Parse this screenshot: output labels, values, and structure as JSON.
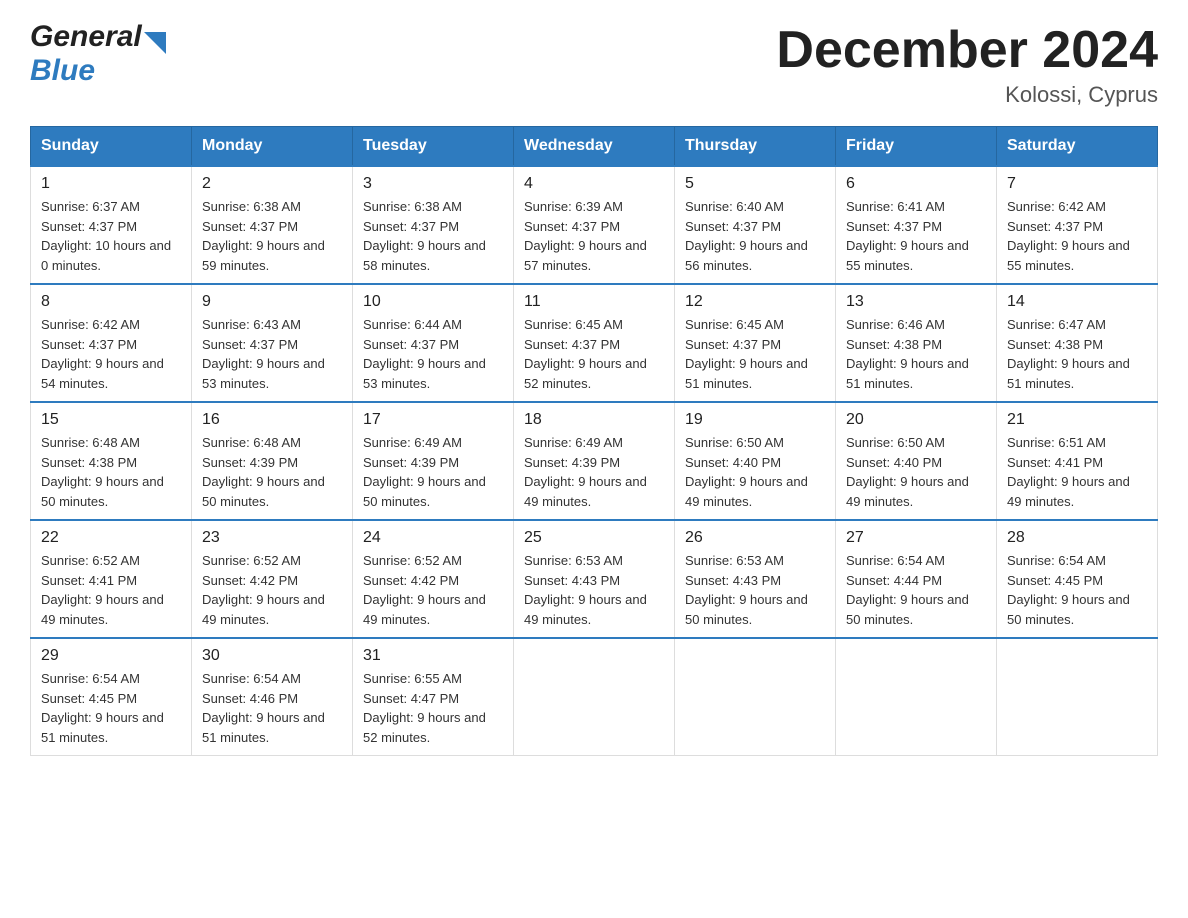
{
  "header": {
    "logo_general": "General",
    "logo_blue": "Blue",
    "title": "December 2024",
    "subtitle": "Kolossi, Cyprus"
  },
  "days_of_week": [
    "Sunday",
    "Monday",
    "Tuesday",
    "Wednesday",
    "Thursday",
    "Friday",
    "Saturday"
  ],
  "weeks": [
    [
      {
        "num": "1",
        "sunrise": "6:37 AM",
        "sunset": "4:37 PM",
        "daylight": "10 hours and 0 minutes."
      },
      {
        "num": "2",
        "sunrise": "6:38 AM",
        "sunset": "4:37 PM",
        "daylight": "9 hours and 59 minutes."
      },
      {
        "num": "3",
        "sunrise": "6:38 AM",
        "sunset": "4:37 PM",
        "daylight": "9 hours and 58 minutes."
      },
      {
        "num": "4",
        "sunrise": "6:39 AM",
        "sunset": "4:37 PM",
        "daylight": "9 hours and 57 minutes."
      },
      {
        "num": "5",
        "sunrise": "6:40 AM",
        "sunset": "4:37 PM",
        "daylight": "9 hours and 56 minutes."
      },
      {
        "num": "6",
        "sunrise": "6:41 AM",
        "sunset": "4:37 PM",
        "daylight": "9 hours and 55 minutes."
      },
      {
        "num": "7",
        "sunrise": "6:42 AM",
        "sunset": "4:37 PM",
        "daylight": "9 hours and 55 minutes."
      }
    ],
    [
      {
        "num": "8",
        "sunrise": "6:42 AM",
        "sunset": "4:37 PM",
        "daylight": "9 hours and 54 minutes."
      },
      {
        "num": "9",
        "sunrise": "6:43 AM",
        "sunset": "4:37 PM",
        "daylight": "9 hours and 53 minutes."
      },
      {
        "num": "10",
        "sunrise": "6:44 AM",
        "sunset": "4:37 PM",
        "daylight": "9 hours and 53 minutes."
      },
      {
        "num": "11",
        "sunrise": "6:45 AM",
        "sunset": "4:37 PM",
        "daylight": "9 hours and 52 minutes."
      },
      {
        "num": "12",
        "sunrise": "6:45 AM",
        "sunset": "4:37 PM",
        "daylight": "9 hours and 51 minutes."
      },
      {
        "num": "13",
        "sunrise": "6:46 AM",
        "sunset": "4:38 PM",
        "daylight": "9 hours and 51 minutes."
      },
      {
        "num": "14",
        "sunrise": "6:47 AM",
        "sunset": "4:38 PM",
        "daylight": "9 hours and 51 minutes."
      }
    ],
    [
      {
        "num": "15",
        "sunrise": "6:48 AM",
        "sunset": "4:38 PM",
        "daylight": "9 hours and 50 minutes."
      },
      {
        "num": "16",
        "sunrise": "6:48 AM",
        "sunset": "4:39 PM",
        "daylight": "9 hours and 50 minutes."
      },
      {
        "num": "17",
        "sunrise": "6:49 AM",
        "sunset": "4:39 PM",
        "daylight": "9 hours and 50 minutes."
      },
      {
        "num": "18",
        "sunrise": "6:49 AM",
        "sunset": "4:39 PM",
        "daylight": "9 hours and 49 minutes."
      },
      {
        "num": "19",
        "sunrise": "6:50 AM",
        "sunset": "4:40 PM",
        "daylight": "9 hours and 49 minutes."
      },
      {
        "num": "20",
        "sunrise": "6:50 AM",
        "sunset": "4:40 PM",
        "daylight": "9 hours and 49 minutes."
      },
      {
        "num": "21",
        "sunrise": "6:51 AM",
        "sunset": "4:41 PM",
        "daylight": "9 hours and 49 minutes."
      }
    ],
    [
      {
        "num": "22",
        "sunrise": "6:52 AM",
        "sunset": "4:41 PM",
        "daylight": "9 hours and 49 minutes."
      },
      {
        "num": "23",
        "sunrise": "6:52 AM",
        "sunset": "4:42 PM",
        "daylight": "9 hours and 49 minutes."
      },
      {
        "num": "24",
        "sunrise": "6:52 AM",
        "sunset": "4:42 PM",
        "daylight": "9 hours and 49 minutes."
      },
      {
        "num": "25",
        "sunrise": "6:53 AM",
        "sunset": "4:43 PM",
        "daylight": "9 hours and 49 minutes."
      },
      {
        "num": "26",
        "sunrise": "6:53 AM",
        "sunset": "4:43 PM",
        "daylight": "9 hours and 50 minutes."
      },
      {
        "num": "27",
        "sunrise": "6:54 AM",
        "sunset": "4:44 PM",
        "daylight": "9 hours and 50 minutes."
      },
      {
        "num": "28",
        "sunrise": "6:54 AM",
        "sunset": "4:45 PM",
        "daylight": "9 hours and 50 minutes."
      }
    ],
    [
      {
        "num": "29",
        "sunrise": "6:54 AM",
        "sunset": "4:45 PM",
        "daylight": "9 hours and 51 minutes."
      },
      {
        "num": "30",
        "sunrise": "6:54 AM",
        "sunset": "4:46 PM",
        "daylight": "9 hours and 51 minutes."
      },
      {
        "num": "31",
        "sunrise": "6:55 AM",
        "sunset": "4:47 PM",
        "daylight": "9 hours and 52 minutes."
      },
      null,
      null,
      null,
      null
    ]
  ],
  "labels": {
    "sunrise": "Sunrise:",
    "sunset": "Sunset:",
    "daylight": "Daylight:"
  }
}
